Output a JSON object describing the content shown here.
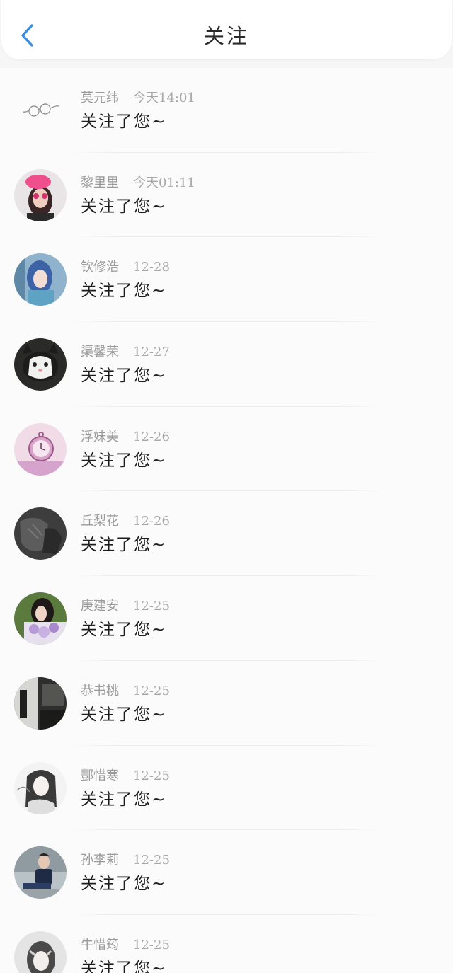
{
  "header": {
    "title": "关注",
    "back_icon": "chevron-left-icon",
    "accent_color": "#3a8ee6"
  },
  "follows": [
    {
      "name": "莫元纬",
      "time": "今天14:01",
      "message": "关注了您~",
      "avatar": "glasses-sketch"
    },
    {
      "name": "黎里里",
      "time": "今天01:11",
      "message": "关注了您~",
      "avatar": "girl-pink-bow"
    },
    {
      "name": "钦修浩",
      "time": "12-28",
      "message": "关注了您~",
      "avatar": "anime-blue-hair"
    },
    {
      "name": "渠馨荣",
      "time": "12-27",
      "message": "关注了您~",
      "avatar": "cat"
    },
    {
      "name": "浮妹美",
      "time": "12-26",
      "message": "关注了您~",
      "avatar": "pocket-watch"
    },
    {
      "name": "丘梨花",
      "time": "12-26",
      "message": "关注了您~",
      "avatar": "dark-photo"
    },
    {
      "name": "庚建安",
      "time": "12-25",
      "message": "关注了您~",
      "avatar": "woman-lavender"
    },
    {
      "name": "恭书桃",
      "time": "12-25",
      "message": "关注了您~",
      "avatar": "street-bw"
    },
    {
      "name": "酆惜寒",
      "time": "12-25",
      "message": "关注了您~",
      "avatar": "anime-sketch"
    },
    {
      "name": "孙李莉",
      "time": "12-25",
      "message": "关注了您~",
      "avatar": "man-sitting"
    },
    {
      "name": "牛惜筠",
      "time": "12-25",
      "message": "关注了您~",
      "avatar": "girl-bw"
    }
  ]
}
